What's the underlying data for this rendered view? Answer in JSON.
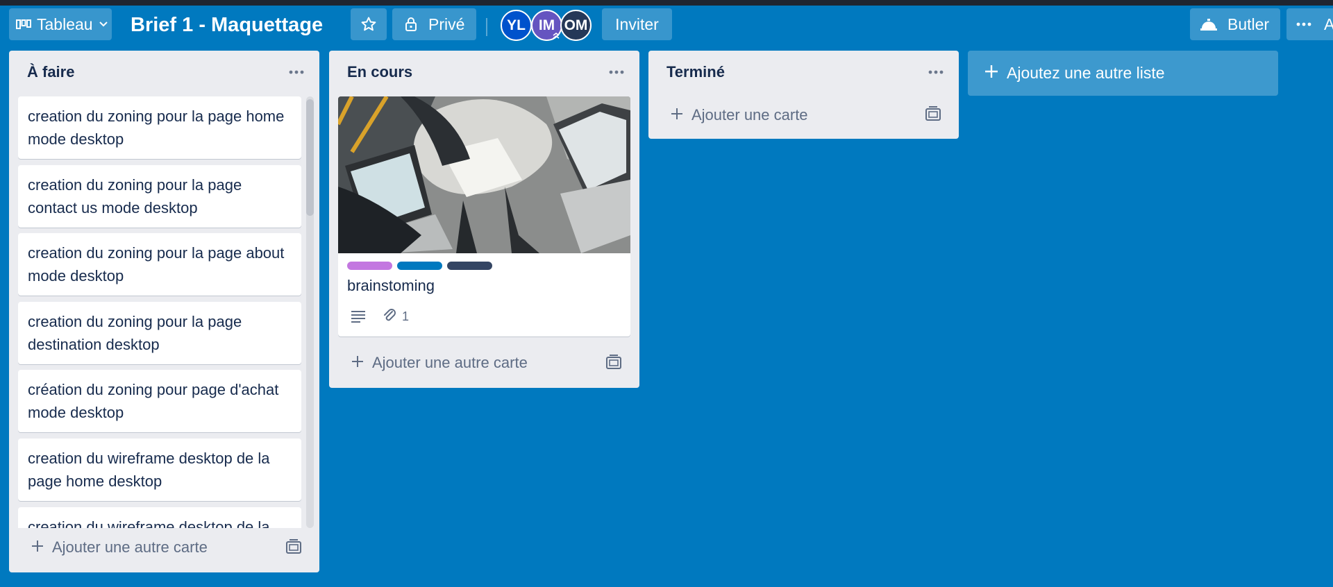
{
  "header": {
    "board_switch_label": "Tableau",
    "board_title": "Brief 1 - Maquettage",
    "visibility_label": "Privé",
    "avatars": [
      {
        "initials": "YL",
        "color": "#0052cc"
      },
      {
        "initials": "IM",
        "color": "#6554c0"
      },
      {
        "initials": "OM",
        "color": "#253858"
      }
    ],
    "invite_label": "Inviter",
    "butler_label": "Butler",
    "menu_truncated_label": "A"
  },
  "lists": [
    {
      "title": "À faire",
      "cards": [
        "creation du zoning pour la page home mode desktop",
        "creation du zoning pour la page contact us mode desktop",
        "creation du zoning pour la page about mode desktop",
        "creation du zoning pour la page destination desktop",
        "création du zoning pour page d'achat mode desktop",
        "creation du wireframe desktop de la page home desktop",
        "creation du wireframe desktop de la page contact us desktop"
      ],
      "add_card_label": "Ajouter une autre carte"
    },
    {
      "title": "En cours",
      "cover_card": {
        "title": "brainstoming",
        "labels": [
          "#c377e0",
          "#0079bf",
          "#344563"
        ],
        "attachments_count": "1"
      },
      "add_card_label": "Ajouter une autre carte"
    },
    {
      "title": "Terminé",
      "add_card_label": "Ajouter une carte"
    }
  ],
  "add_list_label": "Ajoutez une autre liste"
}
